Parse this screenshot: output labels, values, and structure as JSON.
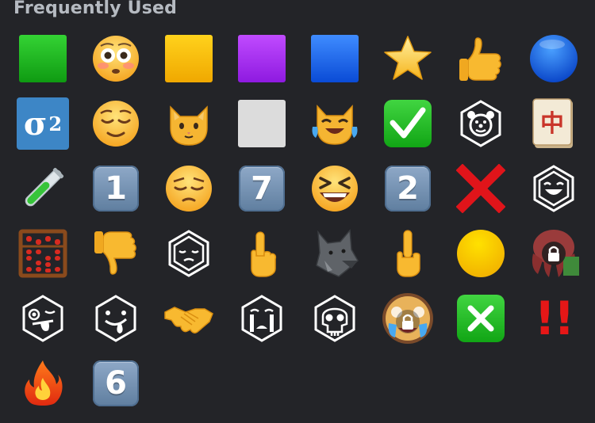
{
  "section": {
    "title": "Frequently Used"
  },
  "emojis": [
    {
      "name": "green-square-icon"
    },
    {
      "name": "flushed-face-icon"
    },
    {
      "name": "yellow-square-icon"
    },
    {
      "name": "purple-square-icon"
    },
    {
      "name": "blue-square-icon"
    },
    {
      "name": "star-icon"
    },
    {
      "name": "thumbs-up-icon"
    },
    {
      "name": "blue-circle-icon"
    },
    {
      "name": "sigma-squared-icon",
      "text": "σ",
      "sup": "2"
    },
    {
      "name": "relieved-face-icon"
    },
    {
      "name": "cat-face-icon"
    },
    {
      "name": "white-square-icon"
    },
    {
      "name": "cat-tears-of-joy-icon"
    },
    {
      "name": "check-mark-button-icon"
    },
    {
      "name": "clown-hexagon-icon"
    },
    {
      "name": "mahjong-red-dragon-icon",
      "text": "中"
    },
    {
      "name": "test-tube-icon"
    },
    {
      "name": "keycap-1-icon",
      "text": "1"
    },
    {
      "name": "pensive-face-icon"
    },
    {
      "name": "keycap-7-icon",
      "text": "7"
    },
    {
      "name": "grinning-squinting-face-icon"
    },
    {
      "name": "keycap-2-icon",
      "text": "2"
    },
    {
      "name": "cross-mark-icon"
    },
    {
      "name": "laughing-hexagon-icon"
    },
    {
      "name": "abacus-icon"
    },
    {
      "name": "thumbs-down-icon"
    },
    {
      "name": "pensive-hexagon-icon"
    },
    {
      "name": "pointing-up-icon"
    },
    {
      "name": "wolf-icon"
    },
    {
      "name": "middle-finger-icon"
    },
    {
      "name": "yellow-circle-icon"
    },
    {
      "name": "locked-octopus-icon"
    },
    {
      "name": "tongue-wink-hexagon-icon"
    },
    {
      "name": "drooling-hexagon-icon"
    },
    {
      "name": "handshake-icon"
    },
    {
      "name": "crying-hexagon-icon"
    },
    {
      "name": "skull-hexagon-icon"
    },
    {
      "name": "locked-crying-face-icon"
    },
    {
      "name": "cross-mark-button-icon"
    },
    {
      "name": "double-exclamation-icon",
      "text": "!!"
    },
    {
      "name": "fire-icon"
    },
    {
      "name": "keycap-6-icon",
      "text": "6"
    }
  ]
}
